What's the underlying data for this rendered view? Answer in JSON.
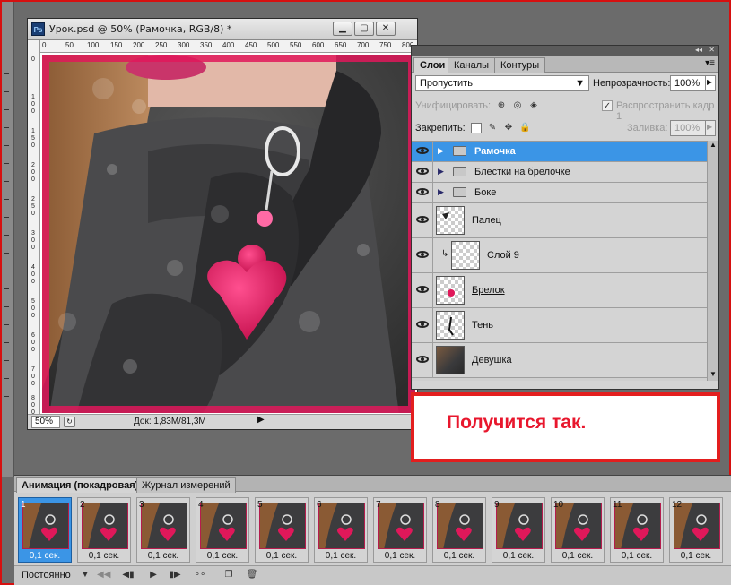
{
  "document": {
    "title": "Урок.psd @ 50% (Рамочка, RGB/8) *",
    "ps_badge": "Ps",
    "zoom": "50%",
    "doc_info": "Док: 1,83M/81,3M",
    "ruler_top": [
      "0",
      "50",
      "100",
      "150",
      "200",
      "250",
      "300",
      "350",
      "400",
      "450",
      "500",
      "550",
      "600",
      "650",
      "700",
      "750",
      "800"
    ],
    "ruler_left": [
      "0",
      "1 0 0",
      "1 5 0",
      "2 0 0",
      "2 5 0",
      "3 0 0",
      "4 0 0",
      "5 0 0",
      "6 0 0",
      "7 0 0",
      "8 0 0"
    ]
  },
  "layers_panel": {
    "tabs": [
      "Слои",
      "Каналы",
      "Контуры"
    ],
    "blend_mode": "Пропустить",
    "opacity_label": "Непрозрачность:",
    "opacity_value": "100%",
    "unify_label": "Унифицировать:",
    "propagate_label": "Распространить кадр 1",
    "lock_label": "Закрепить:",
    "fill_label": "Заливка:",
    "fill_value": "100%",
    "layers": [
      {
        "name": "Рамочка",
        "type": "group",
        "selected": true
      },
      {
        "name": "Блестки на брелочке",
        "type": "group",
        "selected": false
      },
      {
        "name": "Боке",
        "type": "group",
        "selected": false
      },
      {
        "name": "Палец",
        "type": "layer",
        "selected": false
      },
      {
        "name": "Слой 9",
        "type": "clipped",
        "selected": false
      },
      {
        "name": "Брелок",
        "type": "layer",
        "selected": false
      },
      {
        "name": "Тень",
        "type": "layer",
        "selected": false
      },
      {
        "name": "Девушка",
        "type": "layer",
        "selected": false
      }
    ]
  },
  "callout": {
    "text": "Получится так.",
    "color": "#e8172d"
  },
  "animation_panel": {
    "tabs": [
      "Анимация (покадровая)",
      "Журнал измерений"
    ],
    "frames": [
      {
        "num": "1",
        "delay": "0,1 сек."
      },
      {
        "num": "2",
        "delay": "0,1 сек."
      },
      {
        "num": "3",
        "delay": "0,1 сек."
      },
      {
        "num": "4",
        "delay": "0,1 сек."
      },
      {
        "num": "5",
        "delay": "0,1 сек."
      },
      {
        "num": "6",
        "delay": "0,1 сек."
      },
      {
        "num": "7",
        "delay": "0,1 сек."
      },
      {
        "num": "8",
        "delay": "0,1 сек."
      },
      {
        "num": "9",
        "delay": "0,1 сек."
      },
      {
        "num": "10",
        "delay": "0,1 сек."
      },
      {
        "num": "11",
        "delay": "0,1 сек."
      },
      {
        "num": "12",
        "delay": "0,1 сек."
      }
    ],
    "loop": "Постоянно",
    "selected_frame": "1"
  },
  "colors": {
    "selection": "#3b95e6",
    "highlight_border": "#e31e1e",
    "frame_pink": "#d7195e"
  }
}
